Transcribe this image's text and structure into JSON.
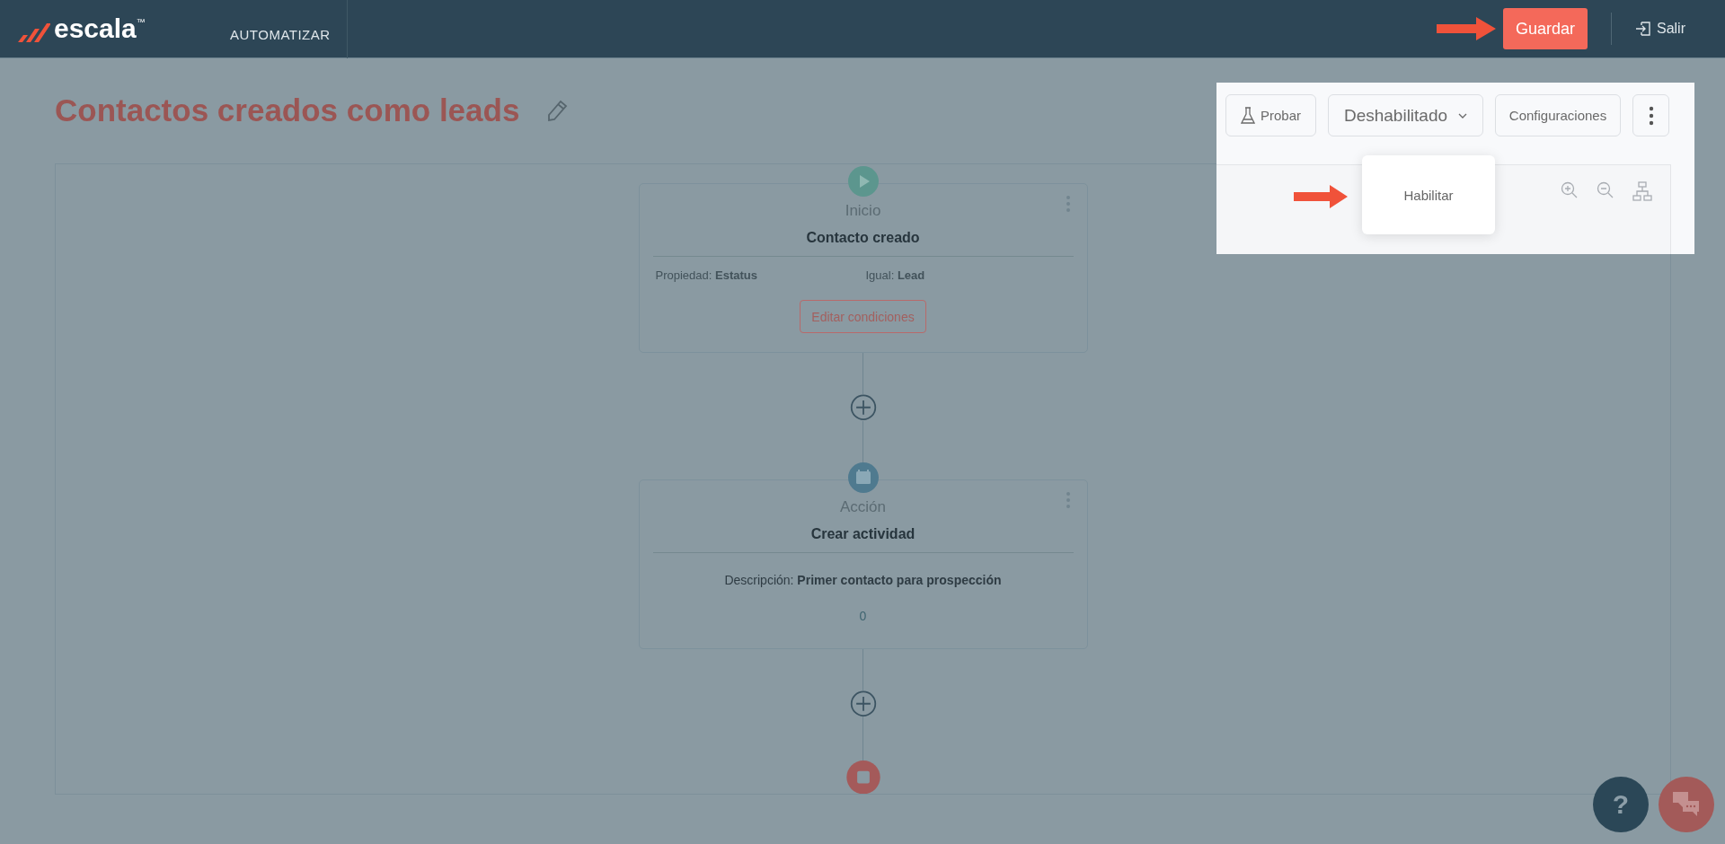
{
  "header": {
    "logo_text": "escala",
    "trademark": "™",
    "nav_item": "AUTOMATIZAR",
    "save_button": "Guardar",
    "exit_link": "Salir"
  },
  "title": "Contactos creados como leads",
  "toolbar": {
    "test_button": "Probar",
    "status_dropdown": "Deshabilitado",
    "settings_button": "Configuraciones"
  },
  "status_menu": [
    {
      "label": "Habilitar"
    }
  ],
  "nodes": [
    {
      "kind": "trigger",
      "type_label": "Inicio",
      "name": "Contacto creado",
      "conditions": [
        "Propiedad: **Estatus**",
        "Igual: **Lead**"
      ],
      "button": "Editar condiciones"
    },
    {
      "kind": "action",
      "type_label": "Acción",
      "name": "Crear actividad",
      "detail": "Descripción: **Primer contacto para prospección**",
      "count": "0"
    }
  ],
  "help_button": "?"
}
